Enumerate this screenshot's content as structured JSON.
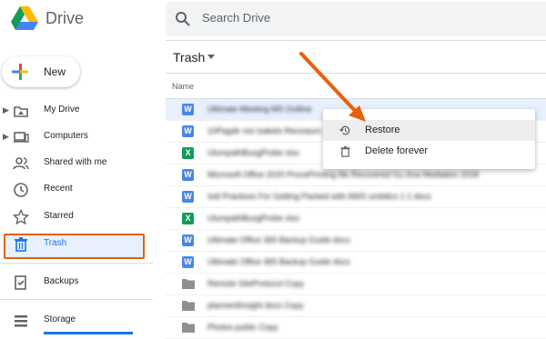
{
  "app": {
    "title": "Drive"
  },
  "search": {
    "placeholder": "Search Drive"
  },
  "new_button": {
    "label": "New"
  },
  "sidebar": {
    "items": [
      {
        "label": "My Drive",
        "icon": "drive-folder-icon"
      },
      {
        "label": "Computers",
        "icon": "computer-icon"
      },
      {
        "label": "Shared with me",
        "icon": "shared-people-icon"
      },
      {
        "label": "Recent",
        "icon": "clock-icon"
      },
      {
        "label": "Starred",
        "icon": "star-icon"
      },
      {
        "label": "Trash",
        "icon": "trash-icon"
      },
      {
        "label": "Backups",
        "icon": "backup-icon"
      },
      {
        "label": "Storage",
        "icon": "storage-icon"
      }
    ]
  },
  "main": {
    "breadcrumb": "Trash",
    "column_header": "Name",
    "files": [
      {
        "type": "word",
        "name": "Ultimate Meeting MS Outline"
      },
      {
        "type": "word",
        "name": "10Pagdir visi Isakels Recioaum"
      },
      {
        "type": "excel",
        "name": "UlumpathBuxgProbe xlsx"
      },
      {
        "type": "word",
        "name": "Microsoft Office 2020 ProcePrinting file Recovered Gu Ana Mediation 2018"
      },
      {
        "type": "word",
        "name": "Isdi Practices For Getting Packed with AWS umbilics 1 1 docs"
      },
      {
        "type": "excel",
        "name": "UlumpathBuxgProbe xlsx"
      },
      {
        "type": "word",
        "name": "Ultimate Office 365 Backup Guide docx"
      },
      {
        "type": "word",
        "name": "Ultimate Office 365 Backup Guide docx"
      },
      {
        "type": "folder",
        "name": "Remote SiteProtocol Copy"
      },
      {
        "type": "folder",
        "name": "planneritlnsight docs Copy"
      },
      {
        "type": "folder",
        "name": "Photos public Copy"
      }
    ]
  },
  "context_menu": {
    "items": [
      {
        "label": "Restore",
        "icon": "restore-history-icon"
      },
      {
        "label": "Delete forever",
        "icon": "trash-icon"
      }
    ]
  },
  "colors": {
    "accent": "#1a73e8",
    "annotation": "#e8600d",
    "word": "#4a86e8",
    "excel": "#0f9d58"
  }
}
